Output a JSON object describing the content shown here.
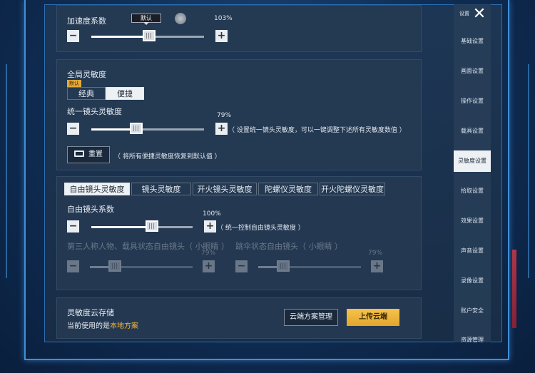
{
  "accel": {
    "label": "加速度系数",
    "bubble": "默认",
    "value_text": "103%",
    "fraction": 0.51
  },
  "global": {
    "title": "全局灵敏度",
    "default_tag": "默认",
    "modes": [
      "经典",
      "便捷"
    ],
    "active_mode": 1,
    "unified_label": "统一镜头灵敏度",
    "unified_value": "79%",
    "unified_fraction": 0.4,
    "unified_hint": "（ 设置统一镜头灵敏度，可以一键调整下述所有灵敏度数值 ）",
    "reset_label": "重置",
    "reset_hint": "（ 将所有便捷灵敏度恢复到默认值 ）"
  },
  "tabs": [
    "自由镜头灵敏度",
    "镜头灵敏度",
    "开火镜头灵敏度",
    "陀螺仪灵敏度",
    "开火陀螺仪灵敏度"
  ],
  "active_tab": 0,
  "free": {
    "label": "自由镜头系数",
    "value": "100%",
    "fraction": 0.6,
    "hint": "（ 统一控制自由镜头灵敏度 ）",
    "sub1_label": "第三人称人物、载具状态自由镜头（ 小眼睛 ）",
    "sub1_value": "79%",
    "sub1_fraction": 0.24,
    "sub2_label": "跳伞状态自由镜头（ 小眼睛 ）",
    "sub2_value": "79%",
    "sub2_fraction": 0.24
  },
  "cloud": {
    "title": "灵敏度云存储",
    "current_prefix": "当前使用的是",
    "current_value": "本地方案",
    "manage_label": "云端方案管理",
    "upload_label": "上传云端"
  },
  "sidebar": {
    "top_label": "设置",
    "items": [
      "基础设置",
      "画面设置",
      "操作设置",
      "载具设置",
      "灵敏度设置",
      "拾取设置",
      "效果设置",
      "声音设置",
      "录像设置",
      "账户安全",
      "资源管理"
    ],
    "active": 4
  },
  "colors": {
    "accent_gold": "#e3a62e",
    "frame_blue": "#3f8fd6",
    "highlight_text": "#f2b640"
  }
}
